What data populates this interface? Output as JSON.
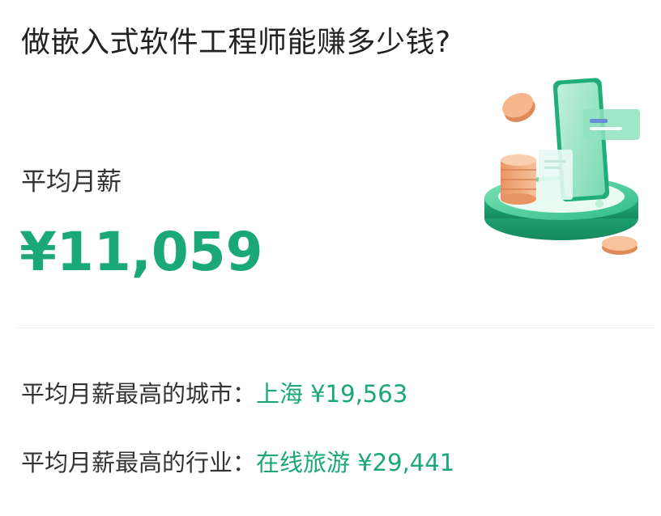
{
  "title": "做嵌入式软件工程师能赚多少钱?",
  "average": {
    "label": "平均月薪",
    "value": "¥11,059"
  },
  "highest_city": {
    "label": "平均月薪最高的城市：",
    "value": "上海 ¥19,563"
  },
  "highest_industry": {
    "label": "平均月薪最高的行业：",
    "value": "在线旅游 ¥29,441"
  },
  "colors": {
    "accent": "#1ba878",
    "text": "#222222",
    "divider": "#eeeeee",
    "coin": "#f0a878"
  },
  "illustration": {
    "icon": "money-phone-podium-icon"
  }
}
